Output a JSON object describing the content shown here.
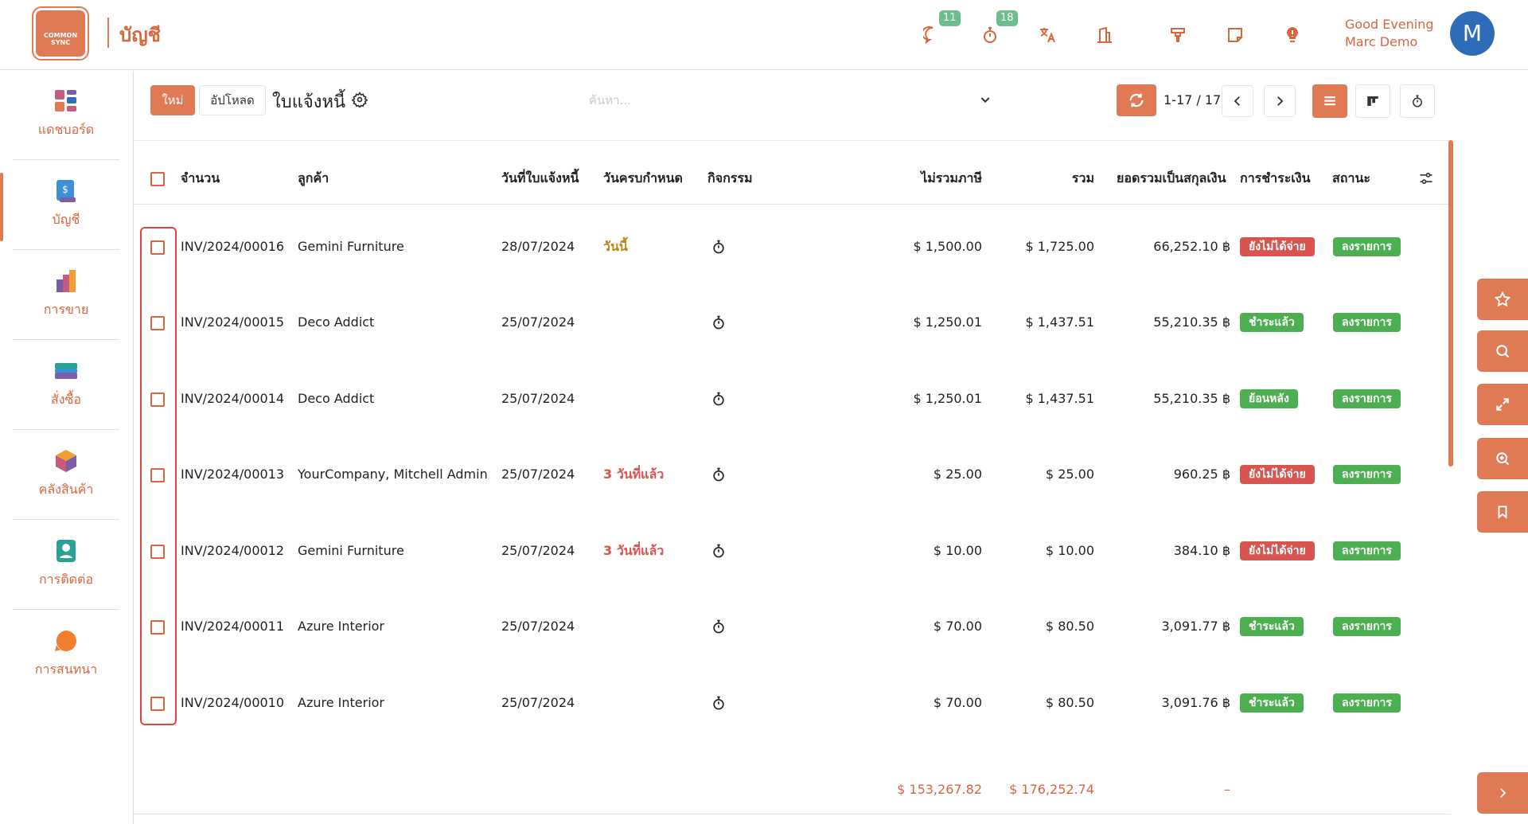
{
  "app": {
    "logo_text": "COMMON SYNC",
    "title": "บัญชี",
    "notifications": {
      "messages_count": "11",
      "activities_count": "18"
    },
    "icons": [
      "chat-icon",
      "stopwatch-icon",
      "translate-icon",
      "company-icon",
      "tools-icon",
      "note-icon",
      "lightbulb-icon"
    ],
    "greeting_line1": "Good Evening",
    "greeting_line2": "Marc Demo",
    "avatar_initial": "M",
    "accent_color": "#e07a55"
  },
  "sidebar": {
    "items": [
      {
        "label": "แดชบอร์ด",
        "icon": "dashboard-icon"
      },
      {
        "label": "บัญชี",
        "icon": "accounting-icon",
        "active": true
      },
      {
        "label": "การขาย",
        "icon": "sales-icon"
      },
      {
        "label": "สั่งซื้อ",
        "icon": "purchase-icon"
      },
      {
        "label": "คลังสินค้า",
        "icon": "inventory-icon"
      },
      {
        "label": "การติดต่อ",
        "icon": "contacts-icon"
      },
      {
        "label": "การสนทนา",
        "icon": "discuss-icon"
      }
    ]
  },
  "control": {
    "new_label": "ใหม่",
    "upload_label": "อัปโหลด",
    "breadcrumb": "ใบแจ้งหนี้",
    "search_placeholder": "ค้นหา...",
    "pager_value": "1-17 / 17"
  },
  "table": {
    "columns": {
      "number": "จำนวน",
      "customer": "ลูกค้า",
      "invoice_date": "วันที่ใบแจ้งหนี้",
      "due_date": "วันครบกำหนด",
      "activity": "กิจกรรม",
      "untaxed": "ไม่รวมภาษี",
      "total": "รวม",
      "total_currency": "ยอดรวมเป็นสกุลเงิน",
      "payment": "การชำระเงิน",
      "status": "สถานะ"
    },
    "rows": [
      {
        "number": "INV/2024/00016",
        "customer": "Gemini Furniture",
        "invoice_date": "28/07/2024",
        "due": "วันนี้",
        "due_color": "#b8860b",
        "untaxed": "$ 1,500.00",
        "total": "$ 1,725.00",
        "total_currency": "66,252.10 ฿",
        "payment": "ยังไม่ได้จ่าย",
        "payment_color": "#d9534f",
        "status": "ลงรายการ",
        "status_color": "#4caf50"
      },
      {
        "number": "INV/2024/00015",
        "customer": "Deco Addict",
        "invoice_date": "25/07/2024",
        "due": "",
        "due_color": "#222222",
        "untaxed": "$ 1,250.01",
        "total": "$ 1,437.51",
        "total_currency": "55,210.35 ฿",
        "payment": "ชำระแล้ว",
        "payment_color": "#4caf50",
        "status": "ลงรายการ",
        "status_color": "#4caf50"
      },
      {
        "number": "INV/2024/00014",
        "customer": "Deco Addict",
        "invoice_date": "25/07/2024",
        "due": "",
        "due_color": "#222222",
        "untaxed": "$ 1,250.01",
        "total": "$ 1,437.51",
        "total_currency": "55,210.35 ฿",
        "payment": "ย้อนหลัง",
        "payment_color": "#4caf50",
        "status": "ลงรายการ",
        "status_color": "#4caf50"
      },
      {
        "number": "INV/2024/00013",
        "customer": "YourCompany, Mitchell Admin",
        "invoice_date": "25/07/2024",
        "due": "3 วันที่แล้ว",
        "due_color": "#d9534f",
        "untaxed": "$ 25.00",
        "total": "$ 25.00",
        "total_currency": "960.25 ฿",
        "payment": "ยังไม่ได้จ่าย",
        "payment_color": "#d9534f",
        "status": "ลงรายการ",
        "status_color": "#4caf50"
      },
      {
        "number": "INV/2024/00012",
        "customer": "Gemini Furniture",
        "invoice_date": "25/07/2024",
        "due": "3 วันที่แล้ว",
        "due_color": "#d9534f",
        "untaxed": "$ 10.00",
        "total": "$ 10.00",
        "total_currency": "384.10 ฿",
        "payment": "ยังไม่ได้จ่าย",
        "payment_color": "#d9534f",
        "status": "ลงรายการ",
        "status_color": "#4caf50"
      },
      {
        "number": "INV/2024/00011",
        "customer": "Azure Interior",
        "invoice_date": "25/07/2024",
        "due": "",
        "due_color": "#222222",
        "untaxed": "$ 70.00",
        "total": "$ 80.50",
        "total_currency": "3,091.77 ฿",
        "payment": "ชำระแล้ว",
        "payment_color": "#4caf50",
        "status": "ลงรายการ",
        "status_color": "#4caf50"
      },
      {
        "number": "INV/2024/00010",
        "customer": "Azure Interior",
        "invoice_date": "25/07/2024",
        "due": "",
        "due_color": "#222222",
        "untaxed": "$ 70.00",
        "total": "$ 80.50",
        "total_currency": "3,091.76 ฿",
        "payment": "ชำระแล้ว",
        "payment_color": "#4caf50",
        "status": "ลงรายการ",
        "status_color": "#4caf50"
      }
    ],
    "totals": {
      "untaxed": "$ 153,267.82",
      "total": "$ 176,252.74",
      "total_currency": "–"
    }
  },
  "right_rail": {
    "icons": [
      "star-icon",
      "search-icon",
      "expand-icon",
      "zoom-in-icon",
      "bookmark-icon",
      "chevron-right-icon"
    ]
  }
}
